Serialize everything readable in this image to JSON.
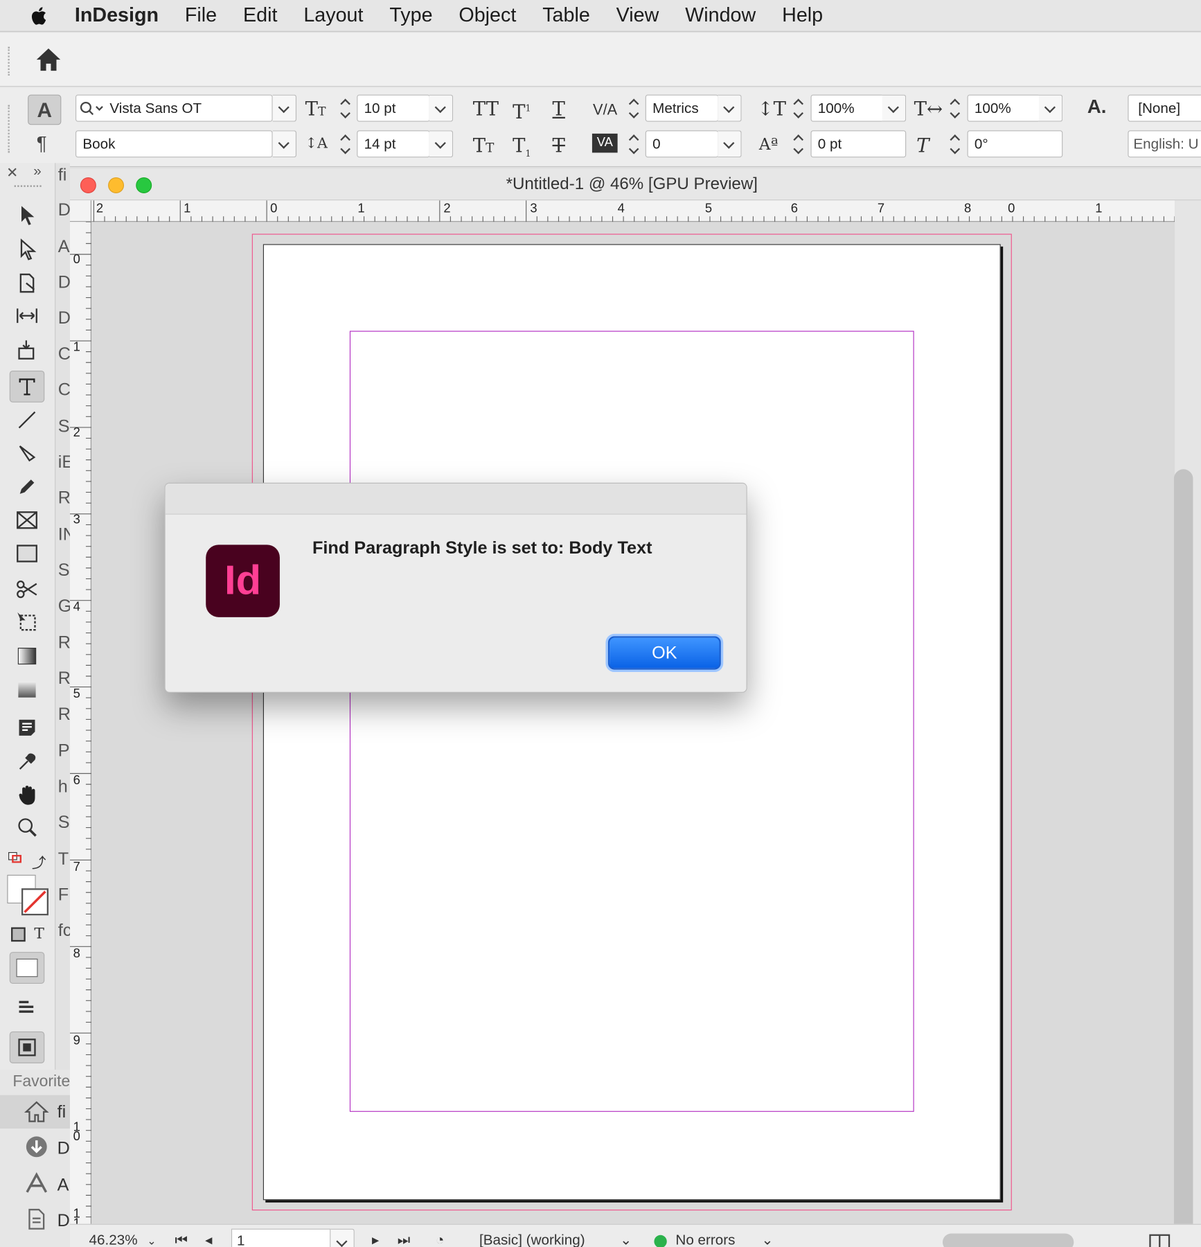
{
  "menubar": {
    "app_name": "InDesign",
    "items": [
      "File",
      "Edit",
      "Layout",
      "Type",
      "Object",
      "Table",
      "View",
      "Window",
      "Help"
    ]
  },
  "control": {
    "font_family": "Vista Sans OT",
    "font_style": "Book",
    "font_size": "10 pt",
    "leading": "14 pt",
    "kerning": "Metrics",
    "tracking": "0",
    "vertical_scale": "100%",
    "horizontal_scale": "100%",
    "baseline_shift": "0 pt",
    "skew": "0°",
    "char_style": "[None]",
    "language": "English: U"
  },
  "document": {
    "title": "*Untitled-1 @ 46% [GPU Preview]",
    "hruler_labels": [
      "2",
      "1",
      "0",
      "1",
      "2",
      "3",
      "4",
      "5",
      "6",
      "7",
      "8",
      "0",
      "1"
    ],
    "vruler_labels": [
      "0",
      "1",
      "2",
      "3",
      "4",
      "5",
      "6",
      "7",
      "8",
      "9",
      "1\n0",
      "1\n1"
    ]
  },
  "panel_strip_letters": [
    "fi",
    "D",
    "A",
    "D",
    "D",
    "C",
    "C",
    "S",
    "iE",
    "R",
    "IN",
    "S",
    "G",
    "R",
    "R",
    "R",
    "P",
    "h",
    "S",
    "T",
    "F",
    "fc"
  ],
  "status": {
    "zoom": "46.23%",
    "page": "1",
    "profile": "[Basic] (working)",
    "preflight": "No errors"
  },
  "favorites": {
    "label": "Favorite",
    "item_letters": [
      "fi",
      "D",
      "A",
      "D"
    ]
  },
  "dialog": {
    "message": "Find Paragraph Style is set to: Body Text",
    "icon_text": "Id",
    "ok_label": "OK"
  },
  "colors": {
    "bleed": "#f0528b",
    "margin": "#b22dc2",
    "indesign_icon_bg": "#49021f",
    "indesign_icon_fg": "#ff3f94",
    "ok_button": "#0a62e6",
    "preflight_ok": "#2bb24c"
  }
}
